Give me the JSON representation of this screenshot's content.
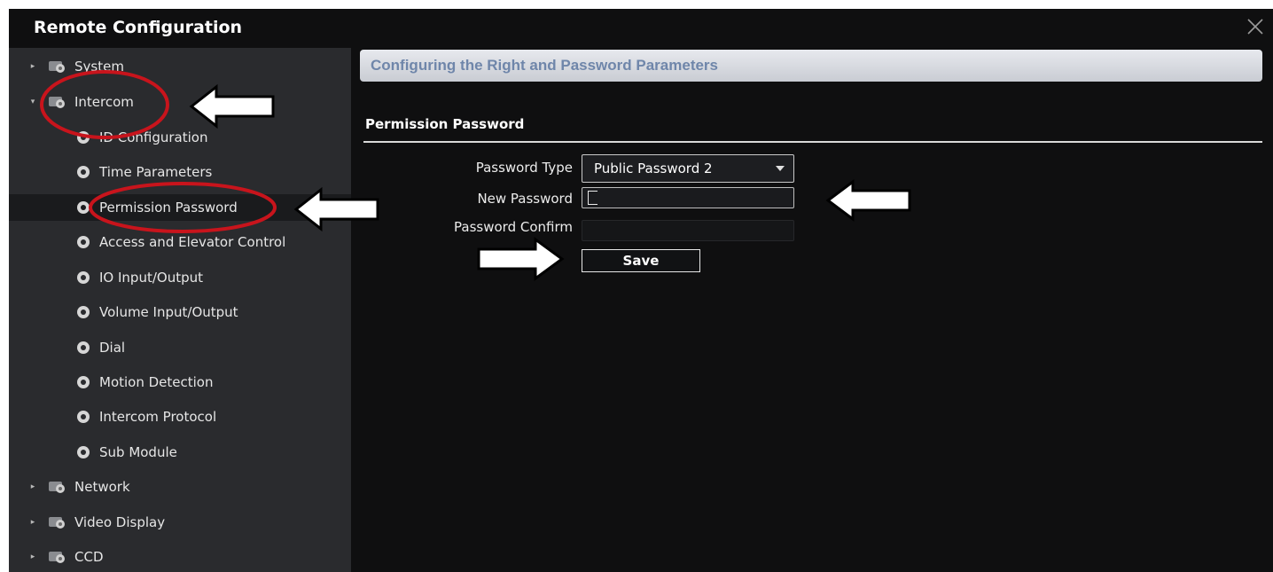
{
  "window": {
    "title": "Remote Configuration",
    "close_icon": "close-icon"
  },
  "sidebar": {
    "items": [
      {
        "label": "System",
        "level": 0,
        "icon": "folder-gear-icon",
        "expander": "collapsed"
      },
      {
        "label": "Intercom",
        "level": 0,
        "icon": "folder-gear-icon",
        "expander": "expanded"
      },
      {
        "label": "ID Configuration",
        "level": 1,
        "icon": "gear-icon"
      },
      {
        "label": "Time Parameters",
        "level": 1,
        "icon": "gear-icon"
      },
      {
        "label": "Permission Password",
        "level": 1,
        "icon": "gear-icon",
        "selected": true
      },
      {
        "label": "Access and Elevator Control",
        "level": 1,
        "icon": "gear-icon"
      },
      {
        "label": "IO Input/Output",
        "level": 1,
        "icon": "gear-icon"
      },
      {
        "label": "Volume Input/Output",
        "level": 1,
        "icon": "gear-icon"
      },
      {
        "label": "Dial",
        "level": 1,
        "icon": "gear-icon"
      },
      {
        "label": "Motion Detection",
        "level": 1,
        "icon": "gear-icon"
      },
      {
        "label": "Intercom Protocol",
        "level": 1,
        "icon": "gear-icon"
      },
      {
        "label": "Sub Module",
        "level": 1,
        "icon": "gear-icon"
      },
      {
        "label": "Network",
        "level": 0,
        "icon": "folder-gear-icon",
        "expander": "collapsed"
      },
      {
        "label": "Video Display",
        "level": 0,
        "icon": "folder-gear-icon",
        "expander": "collapsed"
      },
      {
        "label": "CCD",
        "level": 0,
        "icon": "folder-gear-icon",
        "expander": "collapsed"
      }
    ]
  },
  "main": {
    "header": "Configuring the Right and Password Parameters",
    "section_title": "Permission Password",
    "form": {
      "password_type_label": "Password Type",
      "password_type_value": "Public Password 2",
      "new_password_label": "New Password",
      "new_password_value": "",
      "password_confirm_label": "Password Confirm",
      "password_confirm_value": "",
      "save_label": "Save"
    }
  },
  "annotations": {
    "highlight_color": "#c8141c",
    "arrow_color": "#ffffff",
    "arrow_outline": "#000000"
  },
  "colors": {
    "window_bg": "#0f0f10",
    "sidebar_bg": "#2a2b2e",
    "header_text": "#6f86aa"
  }
}
